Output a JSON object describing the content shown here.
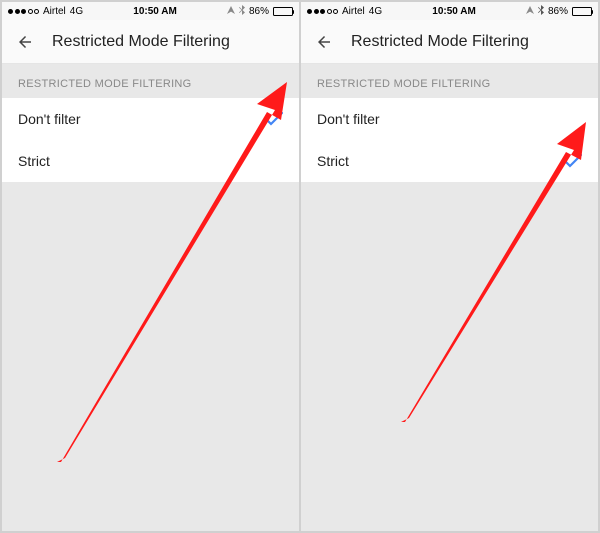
{
  "status_bar": {
    "carrier": "Airtel",
    "network": "4G",
    "time": "10:50 AM",
    "battery_percent": "86%"
  },
  "header": {
    "title": "Restricted Mode Filtering"
  },
  "section_label": "RESTRICTED MODE FILTERING",
  "options": [
    {
      "label": "Don't filter"
    },
    {
      "label": "Strict"
    }
  ],
  "screens": [
    {
      "selected_index": 0
    },
    {
      "selected_index": 1
    }
  ],
  "colors": {
    "check": "#4285f4",
    "arrow": "#ff1a1a"
  }
}
